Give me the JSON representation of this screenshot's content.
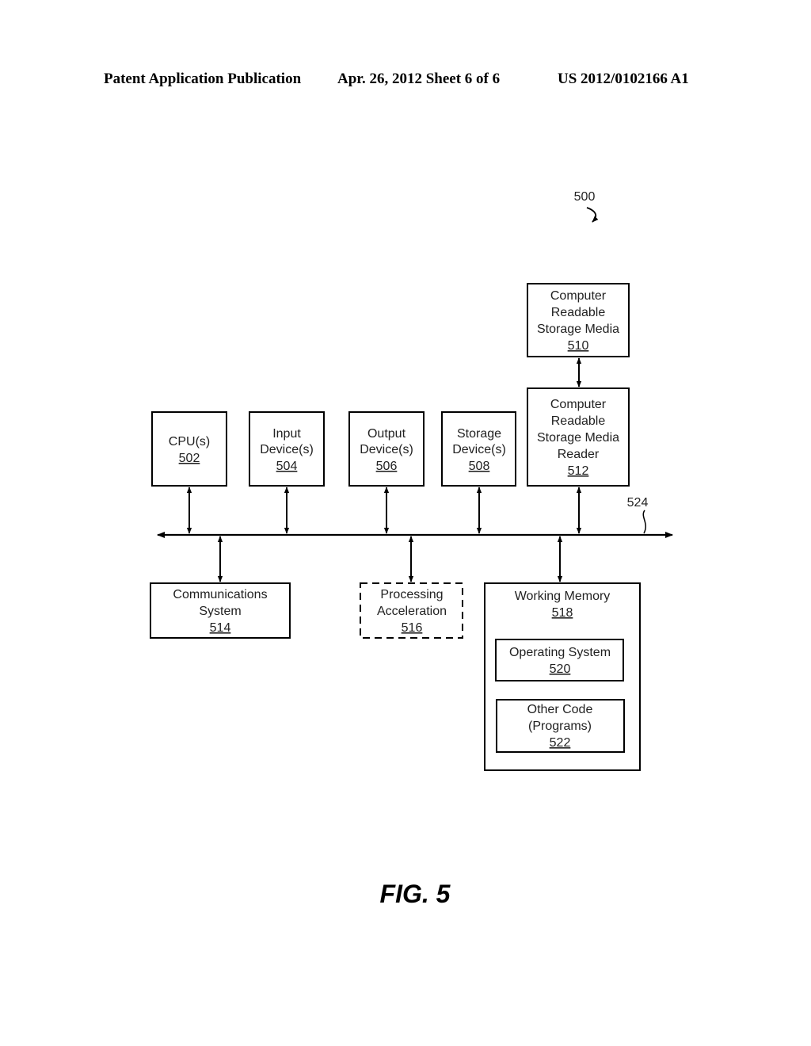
{
  "header": {
    "publication": "Patent Application Publication",
    "date_sheet": "Apr. 26, 2012  Sheet 6 of 6",
    "patent_number": "US 2012/0102166 A1"
  },
  "figure": {
    "ref": "500",
    "caption": "FIG. 5",
    "bus_ref": "524"
  },
  "blocks": {
    "cpu": {
      "lines": [
        "CPU(s)"
      ],
      "ref": "502"
    },
    "input": {
      "lines": [
        "Input",
        "Device(s)"
      ],
      "ref": "504"
    },
    "output": {
      "lines": [
        "Output",
        "Device(s)"
      ],
      "ref": "506"
    },
    "storage": {
      "lines": [
        "Storage",
        "Device(s)"
      ],
      "ref": "508"
    },
    "crsm": {
      "lines": [
        "Computer",
        "Readable",
        "Storage Media"
      ],
      "ref": "510"
    },
    "reader": {
      "lines": [
        "Computer",
        "Readable",
        "Storage Media",
        "Reader"
      ],
      "ref": "512"
    },
    "comm": {
      "lines": [
        "Communications",
        "System"
      ],
      "ref": "514"
    },
    "accel": {
      "lines": [
        "Processing",
        "Acceleration"
      ],
      "ref": "516"
    },
    "memory": {
      "lines": [
        "Working Memory"
      ],
      "ref": "518"
    },
    "os": {
      "lines": [
        "Operating System"
      ],
      "ref": "520"
    },
    "code": {
      "lines": [
        "Other Code",
        "(Programs)"
      ],
      "ref": "522"
    }
  }
}
